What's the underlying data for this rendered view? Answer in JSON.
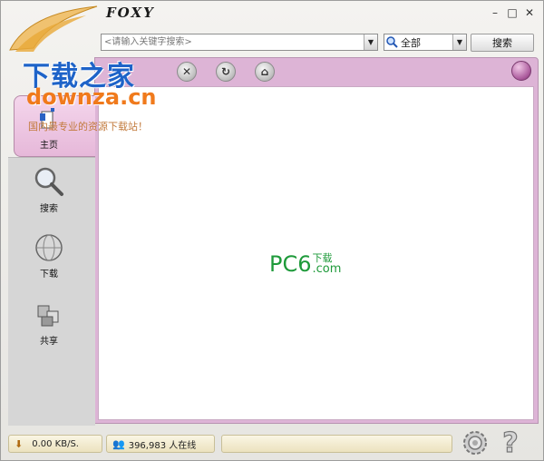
{
  "app": {
    "title": "FOXY"
  },
  "window_controls": {
    "minimize": "–",
    "maximize": "□",
    "close": "✕"
  },
  "search": {
    "placeholder": "<请输入关键字搜索>",
    "scope": "全部",
    "button_label": "搜索"
  },
  "toolbar": {
    "items": [
      {
        "icon": "stop-icon",
        "glyph": "✕"
      },
      {
        "icon": "refresh-icon",
        "glyph": "↻"
      },
      {
        "icon": "home-icon",
        "glyph": "⌂"
      }
    ]
  },
  "sidebar": {
    "items": [
      {
        "label": "主页",
        "icon": "home-page-icon",
        "active": true
      },
      {
        "label": "搜索",
        "icon": "magnifier-icon"
      },
      {
        "label": "下载",
        "icon": "download-globe-icon"
      },
      {
        "label": "共享",
        "icon": "share-cubes-icon"
      }
    ]
  },
  "watermark": {
    "line1": "下载之家",
    "line2": "downza.cn",
    "line3": "国内最专业的资源下载站！"
  },
  "content_logo": {
    "main": "PC6",
    "top": "下载",
    "bottom": ".com"
  },
  "status": {
    "speed": "0.00 KB/S.",
    "online": "396,983 人在线",
    "message": ""
  },
  "colors": {
    "accent_pink": "#ddb4d6",
    "status_bg": "#f6efd4",
    "logo_green": "#1e9a3a"
  }
}
